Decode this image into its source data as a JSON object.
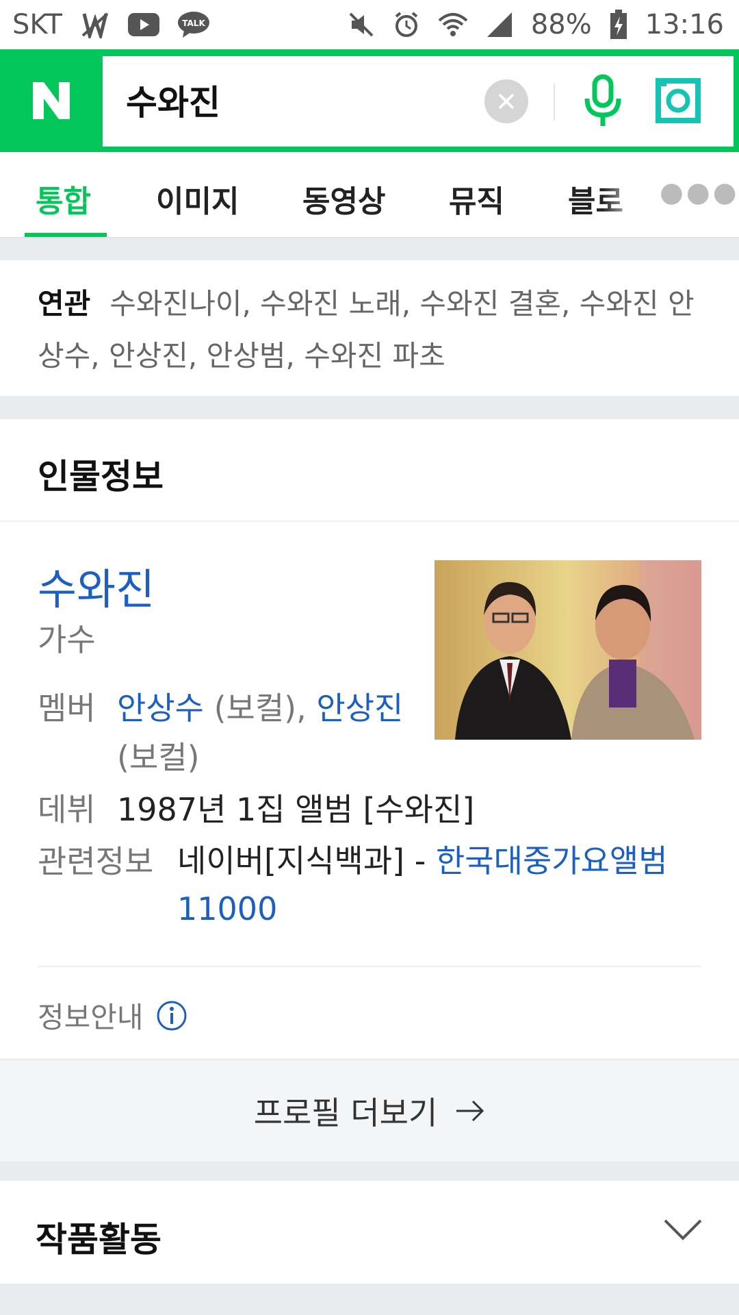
{
  "status_bar": {
    "carrier": "SKT",
    "talk_badge": "TALK",
    "battery": "88%",
    "time": "13:16"
  },
  "search": {
    "logo": "N",
    "query": "수와진"
  },
  "tabs": [
    {
      "label": "통합",
      "active": true
    },
    {
      "label": "이미지"
    },
    {
      "label": "동영상"
    },
    {
      "label": "뮤직"
    },
    {
      "label": "블로"
    }
  ],
  "related": {
    "label": "연관",
    "terms": "수와진나이, 수와진 노래, 수와진 결혼, 수와진 안상수, 안상진, 안상범, 수와진 파초"
  },
  "person": {
    "heading": "인물정보",
    "name": "수와진",
    "job": "가수",
    "member_label": "멤버",
    "member1_name": "안상수",
    "member1_role": " (보컬), ",
    "member2_name": "안상진",
    "member2_role": "(보컬)",
    "debut_label": "데뷔",
    "debut_value": "1987년 1집 앨범 [수와진]",
    "related_label": "관련정보",
    "related_prefix": "네이버[지식백과] - ",
    "related_link": "한국대중가요앨범",
    "related_link2": "11000",
    "notice": "정보안내",
    "profile_more": "프로필 더보기"
  },
  "works": {
    "title": "작품활동"
  },
  "colors": {
    "brand_green": "#03c75a",
    "link_blue": "#1a5fc1"
  },
  "icons": [
    "mute-icon",
    "alarm-icon",
    "wifi-icon",
    "signal-icon",
    "battery-icon",
    "clear-icon",
    "mic-icon",
    "lens-icon",
    "info-icon",
    "arrow-right-icon",
    "chevron-down-icon"
  ]
}
